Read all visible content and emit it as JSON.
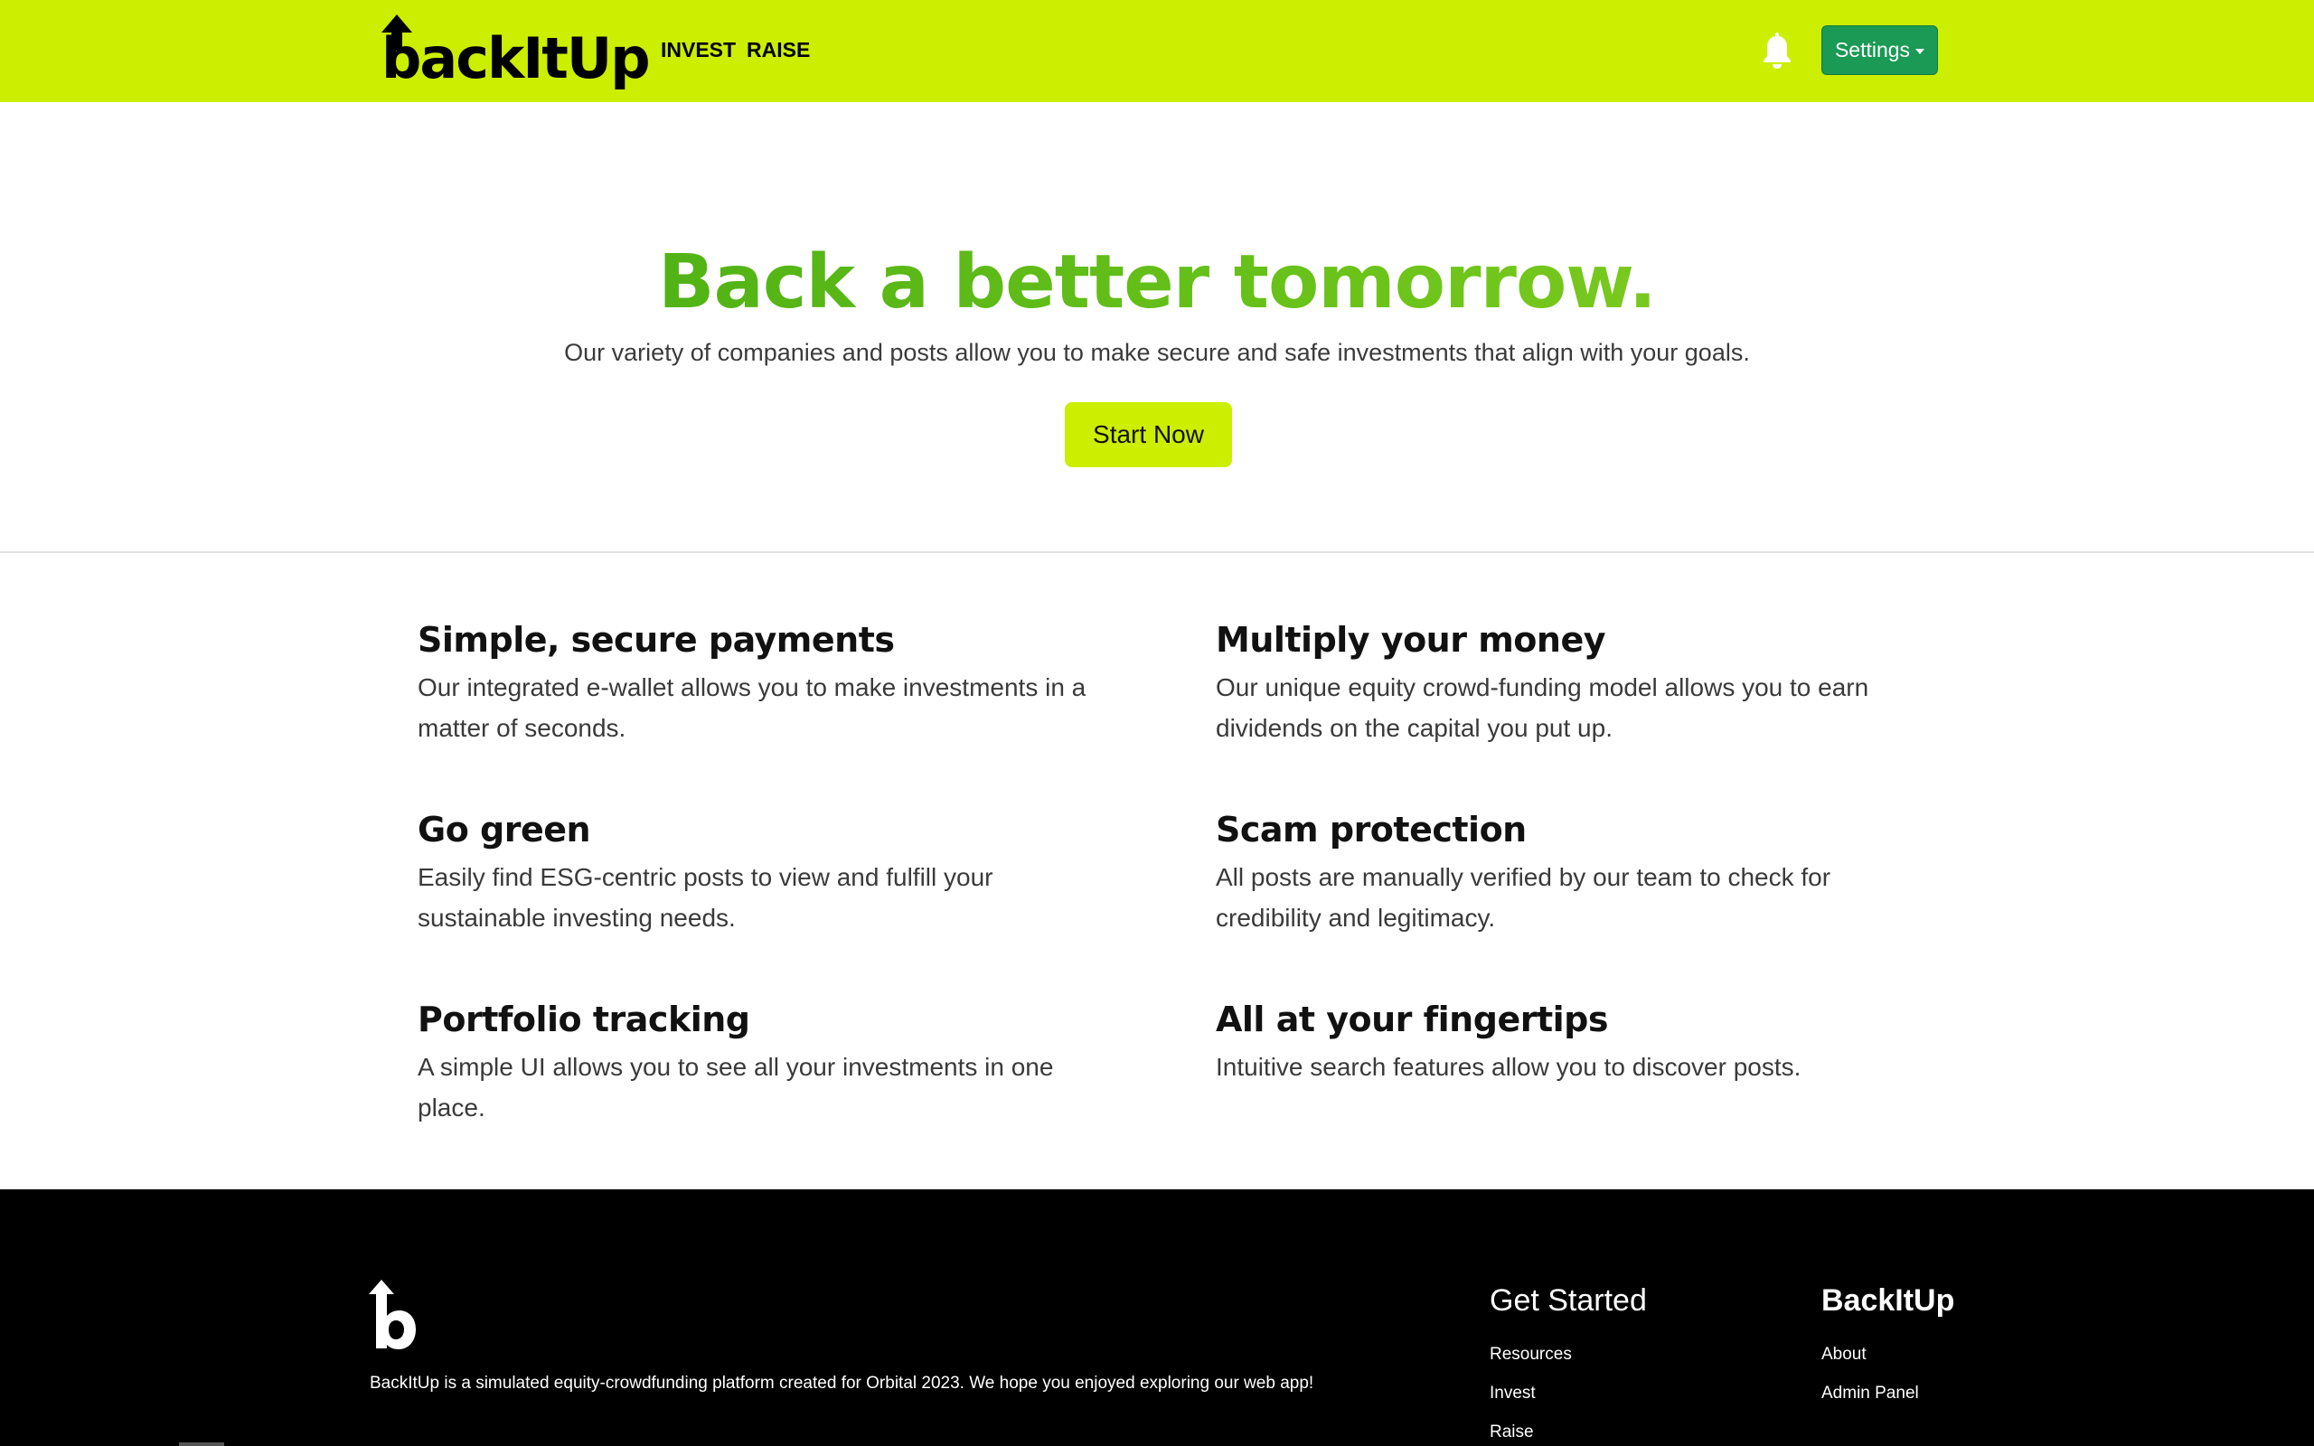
{
  "nav": {
    "logo_text": "backItUp",
    "links": [
      {
        "label": "INVEST"
      },
      {
        "label": "RAISE"
      }
    ],
    "settings_label": "Settings",
    "icons": {
      "bell": "bell-icon",
      "logo": "arrow-up-logo-icon"
    }
  },
  "hero": {
    "title": "Back a better tomorrow.",
    "subtitle": "Our variety of companies and posts allow you to make secure and safe investments that align with your goals.",
    "cta_label": "Start Now"
  },
  "features": [
    {
      "title": "Simple, secure payments",
      "text": "Our integrated e-wallet allows you to make investments in a matter of seconds."
    },
    {
      "title": "Multiply your money",
      "text": "Our unique equity crowd-funding model allows you to earn dividends on the capital you put up."
    },
    {
      "title": "Go green",
      "text": "Easily find ESG-centric posts to view and fulfill your sustainable investing needs."
    },
    {
      "title": "Scam protection",
      "text": "All posts are manually verified by our team to check for credibility and legitimacy."
    },
    {
      "title": "Portfolio tracking",
      "text": "A simple UI allows you to see all your investments in one place."
    },
    {
      "title": "All at your fingertips",
      "text": "Intuitive search features allow you to discover posts."
    }
  ],
  "footer": {
    "description": "BackItUp is a simulated equity-crowdfunding platform created for Orbital 2023. We hope you enjoyed exploring our web app!",
    "get_started": {
      "heading": "Get Started",
      "links": [
        "Resources",
        "Invest",
        "Raise"
      ]
    },
    "backitup": {
      "heading": "BackItUp",
      "links": [
        "About",
        "Admin Panel"
      ]
    }
  },
  "colors": {
    "navbar": "#ccee00",
    "settings_button": "#1a9a54",
    "hero_title_green": "#3aa312",
    "footer_bg": "#000000"
  }
}
